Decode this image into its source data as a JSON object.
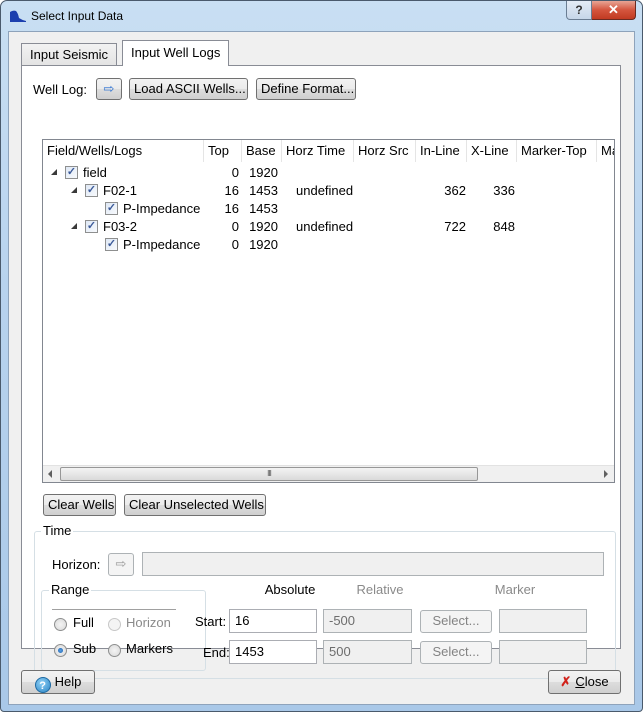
{
  "window": {
    "title": "Select Input Data",
    "help_caption": "?",
    "close_caption": "✕"
  },
  "tabs": [
    {
      "label": "Input Seismic",
      "active": false
    },
    {
      "label": "Input Well Logs",
      "active": true
    }
  ],
  "well_log": {
    "label": "Well Log:",
    "arrow_icon": "⇨",
    "load_button": "Load ASCII Wells...",
    "format_button": "Define Format..."
  },
  "tree": {
    "columns": [
      "Field/Wells/Logs",
      "Top",
      "Base",
      "Horz Time",
      "Horz Src",
      "In-Line",
      "X-Line",
      "Marker-Top",
      "Ma"
    ],
    "rows": [
      {
        "name": "field",
        "level": 0,
        "expandable": true,
        "checked": true,
        "top": "0",
        "base": "1920",
        "horz_time": "",
        "horz_src": "",
        "inline": "",
        "xline": ""
      },
      {
        "name": "F02-1",
        "level": 1,
        "expandable": true,
        "checked": true,
        "top": "16",
        "base": "1453",
        "horz_time": "undefined",
        "horz_src": "",
        "inline": "362",
        "xline": "336"
      },
      {
        "name": "P-Impedance",
        "level": 2,
        "expandable": false,
        "checked": true,
        "top": "16",
        "base": "1453",
        "horz_time": "",
        "horz_src": "",
        "inline": "",
        "xline": ""
      },
      {
        "name": "F03-2",
        "level": 1,
        "expandable": true,
        "checked": true,
        "top": "0",
        "base": "1920",
        "horz_time": "undefined",
        "horz_src": "",
        "inline": "722",
        "xline": "848"
      },
      {
        "name": "P-Impedance",
        "level": 2,
        "expandable": false,
        "checked": true,
        "top": "0",
        "base": "1920",
        "horz_time": "",
        "horz_src": "",
        "inline": "",
        "xline": ""
      }
    ],
    "scroll_grip": "III"
  },
  "actions": {
    "clear_wells": "Clear Wells",
    "clear_unselected": "Clear Unselected Wells"
  },
  "time": {
    "title": "Time",
    "horizon_label": "Horizon:",
    "horizon_arrow": "⇨",
    "horizon_value": "",
    "range": {
      "title": "Range",
      "options": [
        {
          "label": "Full",
          "checked": false,
          "enabled": true
        },
        {
          "label": "Horizon",
          "checked": false,
          "enabled": false
        },
        {
          "label": "Sub",
          "checked": true,
          "enabled": true
        },
        {
          "label": "Markers",
          "checked": false,
          "enabled": true
        }
      ]
    },
    "headers": {
      "absolute": "Absolute",
      "relative": "Relative",
      "marker": "Marker"
    },
    "start": {
      "label": "Start:",
      "absolute": "16",
      "relative": "-500",
      "select": "Select...",
      "marker": ""
    },
    "end": {
      "label": "End:",
      "absolute": "1453",
      "relative": "500",
      "select": "Select...",
      "marker": ""
    }
  },
  "footer": {
    "help": "Help",
    "close_prefix": "",
    "close_underlined": "C",
    "close_rest": "lose"
  }
}
